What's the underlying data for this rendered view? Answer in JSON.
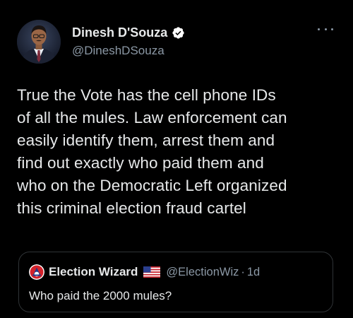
{
  "author": {
    "display_name": "Dinesh D'Souza",
    "handle": "@DineshDSouza",
    "verified": true,
    "avatar_icon": "profile-photo-man-in-suit"
  },
  "tweet": {
    "text": "True the Vote has the cell phone IDs\nof all the mules. Law enforcement can\neasily identify them, arrest them and\nfind out exactly who paid them and\nwho on the Democratic Left organized\nthis criminal election fraud cartel"
  },
  "more_icon": "more-horizontal-icon",
  "quoted_tweet": {
    "display_name": "Election Wizard",
    "flag_icon": "us-flag-icon",
    "handle": "@ElectionWiz",
    "separator": "·",
    "time": "1d",
    "text": "Who paid the 2000 mules?"
  },
  "colors": {
    "background": "#000000",
    "primary_text": "#e7e9ea",
    "secondary_text": "#8b98a5",
    "border": "#2f3336",
    "verified": "#1d9bf0"
  }
}
